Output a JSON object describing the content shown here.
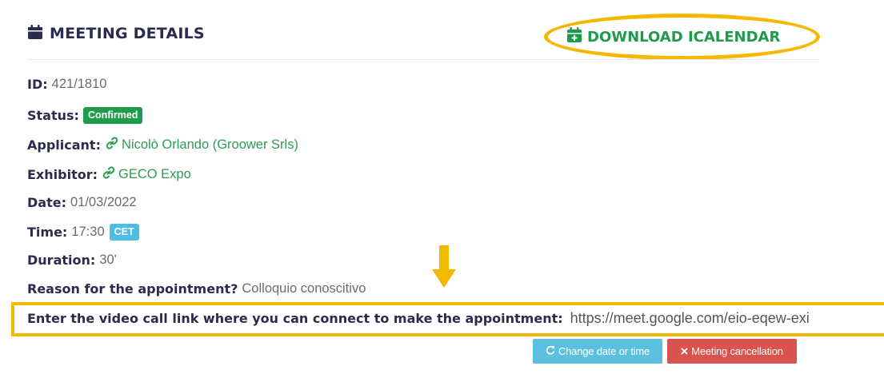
{
  "header": {
    "title": "MEETING DETAILS",
    "title_icon": "calendar-icon",
    "ical_label": "DOWNLOAD ICALENDAR",
    "ical_icon": "calendar-plus-icon"
  },
  "details": {
    "id_label": "ID:",
    "id_value": "421/1810",
    "status_label": "Status:",
    "status_value": "Confirmed",
    "applicant_label": "Applicant:",
    "applicant_value": "Nicolò Orlando (Groower Srls)",
    "exhibitor_label": "Exhibitor:",
    "exhibitor_value": "GECO Expo",
    "date_label": "Date:",
    "date_value": "01/03/2022",
    "time_label": "Time:",
    "time_value": "17:30",
    "timezone": "CET",
    "duration_label": "Duration:",
    "duration_value": "30'",
    "reason_label": "Reason for the appointment?",
    "reason_value": "Colloquio conoscitivo",
    "video_label": "Enter the video call link where you can connect to make the appointment:",
    "video_value": "https://meet.google.com/eio-eqew-exi"
  },
  "actions": {
    "change_label": "Change date or time",
    "change_icon": "refresh-icon",
    "cancel_label": "Meeting cancellation",
    "cancel_icon": "close-icon"
  },
  "colors": {
    "heading": "#2b2b4e",
    "link_green": "#2a9d52",
    "highlight": "#f5b800",
    "status_green": "#1e9b4b",
    "timezone_blue": "#4bbde7",
    "button_blue": "#5bc0de",
    "button_red": "#d9534f"
  }
}
